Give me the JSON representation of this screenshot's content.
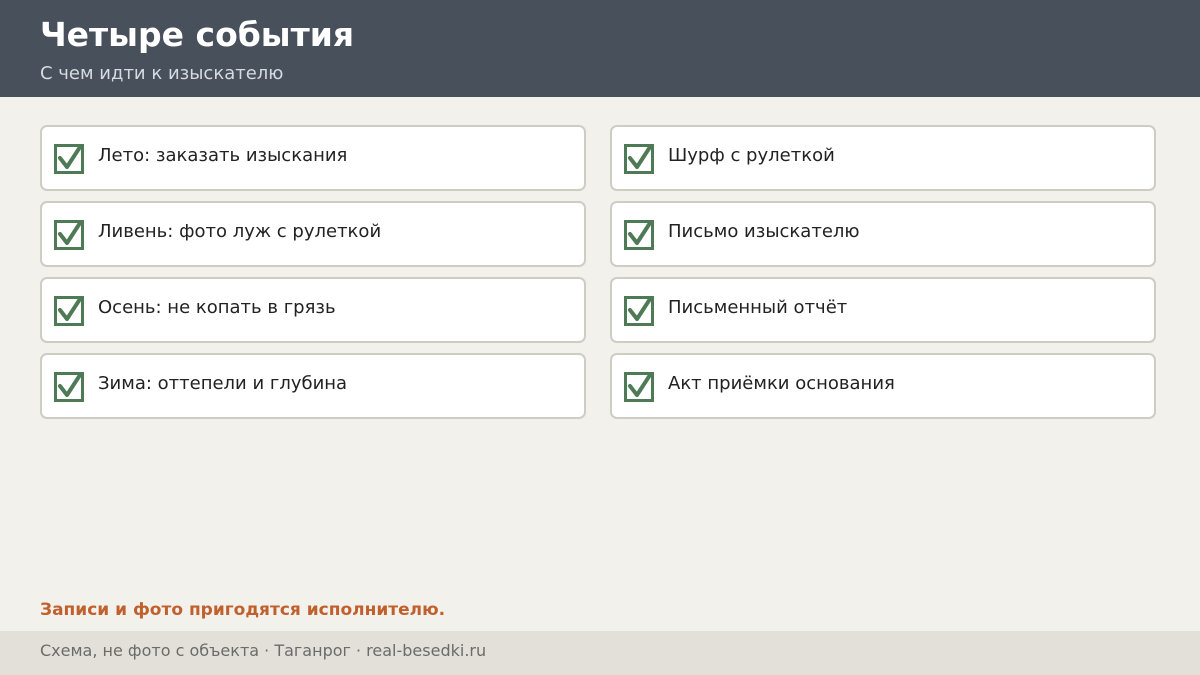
{
  "header": {
    "title": "Четыре события",
    "subtitle": "С чем идти к изыскателю"
  },
  "left_column": [
    {
      "label": "Лето: заказать изыскания",
      "checked": true
    },
    {
      "label": "Ливень: фото луж с рулеткой",
      "checked": true
    },
    {
      "label": "Осень: не копать в грязь",
      "checked": true
    },
    {
      "label": "Зима: оттепели и глубина",
      "checked": true
    }
  ],
  "right_column": [
    {
      "label": "Шурф с рулеткой",
      "checked": true
    },
    {
      "label": "Письмо изыскателю",
      "checked": true
    },
    {
      "label": "Письменный отчёт",
      "checked": true
    },
    {
      "label": "Акт приёмки основания",
      "checked": true
    }
  ],
  "note": "Записи и фото пригодятся исполнителю.",
  "footer": {
    "text": "Схема, не фото с объекта  ·  Таганрог  ·  real-besedki.ru"
  },
  "colors": {
    "header_bg": "#48505c",
    "page_bg": "#f3f1ec",
    "check_green": "#4f7a56",
    "accent_orange": "#c0602d",
    "footer_bg": "#e3e0d9"
  },
  "icons": {
    "check": "checkbox-checked-icon"
  }
}
